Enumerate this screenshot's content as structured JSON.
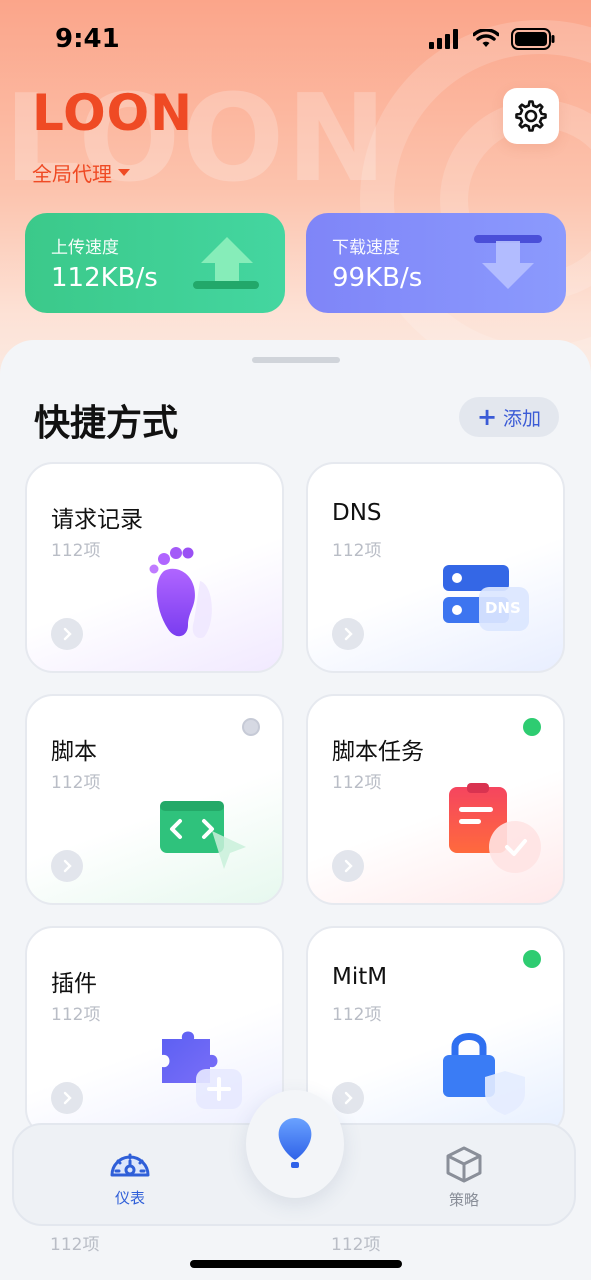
{
  "status_bar": {
    "time": "9:41"
  },
  "header": {
    "brand": "LOON",
    "watermark": "LOON",
    "mode_label": "全局代理"
  },
  "speeds": {
    "upload": {
      "label": "上传速度",
      "value": "112KB/s"
    },
    "download": {
      "label": "下载速度",
      "value": "99KB/s"
    }
  },
  "shortcuts": {
    "title": "快捷方式",
    "add_label": "添加",
    "cards": [
      {
        "title": "请求记录",
        "count": "112项",
        "icon": "footprint-icon"
      },
      {
        "title": "DNS",
        "count": "112项",
        "icon": "dns-server-icon",
        "badge_text": "DNS"
      },
      {
        "title": "脚本",
        "count": "112项",
        "icon": "code-window-icon",
        "status": "off"
      },
      {
        "title": "脚本任务",
        "count": "112项",
        "icon": "clipboard-task-icon",
        "status": "on"
      },
      {
        "title": "插件",
        "count": "112项",
        "icon": "puzzle-icon"
      },
      {
        "title": "MitM",
        "count": "112项",
        "icon": "lock-shield-icon",
        "status": "on"
      }
    ],
    "peek_counts": [
      "112项",
      "112项"
    ]
  },
  "colors": {
    "brand": "#ef4a24",
    "status_on": "#2ecc71",
    "status_off": "#d6d9e3",
    "tab_active": "#2f5fd8"
  },
  "tab_bar": {
    "tabs": [
      {
        "label": "仪表",
        "icon": "dashboard-gauge-icon",
        "active": true
      },
      {
        "label": "策略",
        "icon": "cube-icon",
        "active": false
      }
    ],
    "center_icon": "balloon-icon"
  }
}
